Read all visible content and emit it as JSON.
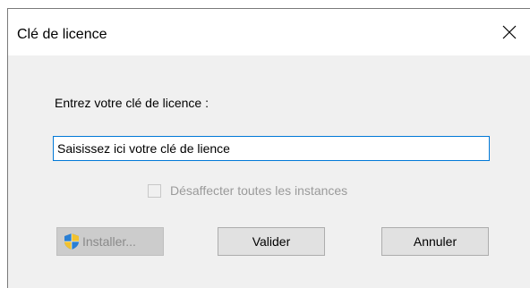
{
  "window": {
    "title": "Clé de licence"
  },
  "dialog": {
    "prompt": "Entrez votre clé de licence :",
    "key_input_value": "Saisissez ici votre clé de lience",
    "deallocate_checkbox": {
      "label": "Désaffecter toutes les instances",
      "checked": false,
      "enabled": false
    }
  },
  "buttons": {
    "install": {
      "label": "Installer...",
      "icon": "uac-shield-icon",
      "enabled": false
    },
    "validate": {
      "label": "Valider"
    },
    "cancel": {
      "label": "Annuler"
    }
  },
  "colors": {
    "focus_border": "#0078d7",
    "dialog_bg": "#f0f0f0",
    "disabled_text": "#9a9a9a"
  }
}
